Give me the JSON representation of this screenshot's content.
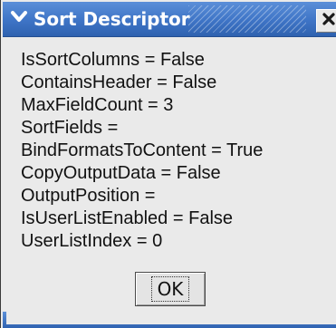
{
  "window": {
    "title": "Sort Descriptor",
    "titlebar_color": "#3e74c6",
    "menu_icon": "chevron-down-icon",
    "close_icon": "close-icon"
  },
  "properties": [
    "IsSortColumns = False",
    "ContainsHeader = False",
    "MaxFieldCount = 3",
    "SortFields =",
    "BindFormatsToContent = True",
    "CopyOutputData = False",
    "OutputPosition =",
    "IsUserListEnabled = False",
    "UserListIndex = 0"
  ],
  "buttons": {
    "ok_label": "OK"
  }
}
